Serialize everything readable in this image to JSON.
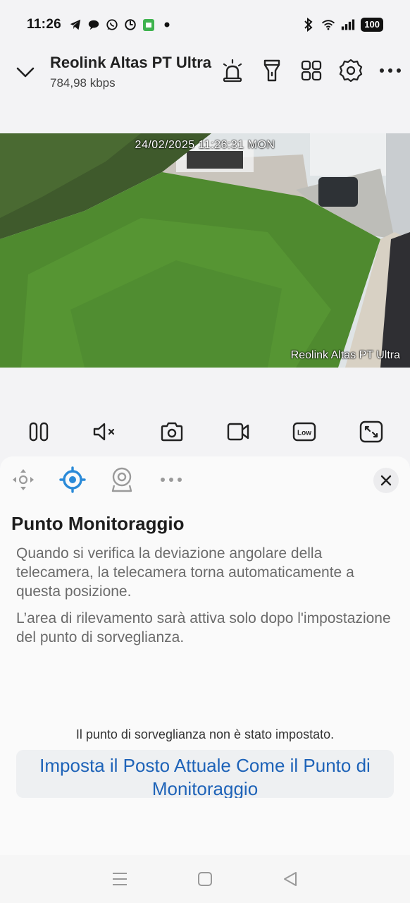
{
  "status_bar": {
    "time": "11:26",
    "battery": "100",
    "left_icons": [
      "telegram-icon",
      "chat-bubble-icon",
      "whatsapp-icon",
      "sync-icon",
      "android-app-icon",
      "dot-icon"
    ],
    "right_icons": [
      "bluetooth-icon",
      "wifi-icon",
      "signal-icon",
      "battery-icon"
    ]
  },
  "header": {
    "title": "Reolink Altas PT Ultra",
    "bitrate": "784,98 kbps",
    "actions": [
      "siren-icon",
      "spotlight-icon",
      "grid-view-icon",
      "settings-icon",
      "more-icon"
    ]
  },
  "video": {
    "timestamp": "24/02/2025 11:26:31 MON",
    "camera_label": "Reolink Altas PT Ultra"
  },
  "controls": [
    "pause-icon",
    "mute-icon",
    "snapshot-icon",
    "record-icon",
    "quality-low-icon",
    "fullscreen-icon"
  ],
  "controls_quality_label": "Low",
  "panel": {
    "tabs": [
      "ptz-direction-icon",
      "monitoring-point-icon",
      "preset-icon",
      "more-icon"
    ],
    "title": "Punto Monitoraggio",
    "description_1": "Quando si verifica la deviazione angolare della telecamera, la telecamera torna automaticamente a questa posizione.",
    "description_2": "L’area di rilevamento sarà attiva solo dopo l'impostazione del punto di sorveglianza.",
    "status_note": "Il punto di sorveglianza non è stato impostato.",
    "action_button": "Imposta il Posto Attuale Come il Punto di Monitoraggio"
  },
  "colors": {
    "accent": "#1e63b8",
    "active_tab": "#2a8ad8",
    "background": "#f3f3f5",
    "panel": "#fafafa"
  }
}
